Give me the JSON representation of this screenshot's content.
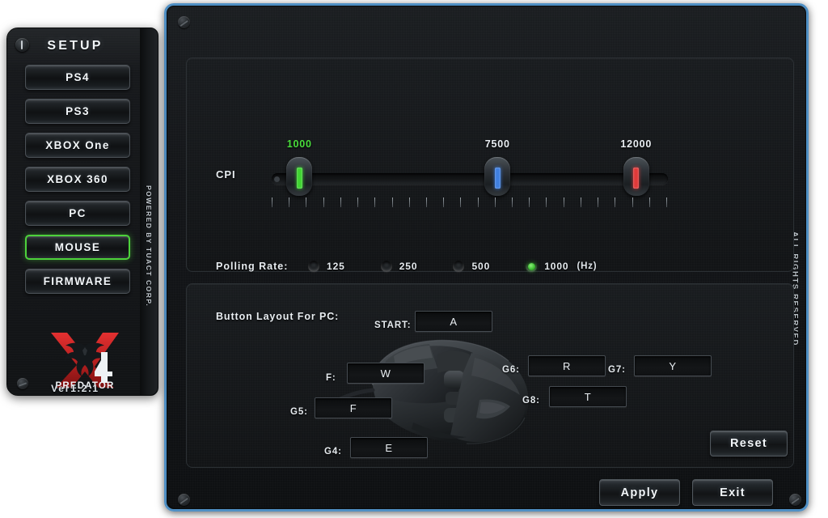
{
  "sidebar": {
    "title": "SETUP",
    "power_icon": "power-icon",
    "items": [
      {
        "label": "PS4",
        "active": false
      },
      {
        "label": "PS3",
        "active": false
      },
      {
        "label": "XBOX One",
        "active": false
      },
      {
        "label": "XBOX 360",
        "active": false
      },
      {
        "label": "PC",
        "active": false
      },
      {
        "label": "MOUSE",
        "active": true
      },
      {
        "label": "FIRMWARE",
        "active": false
      }
    ],
    "logo_brand": "PREDATOR",
    "logo_model": "4",
    "version": "Ver1.2.1",
    "rail_text": "POWERED BY TUACT CORP."
  },
  "window": {
    "rail_text": "ALL RIGHTS RESERVED.",
    "accent_border": "#4f8fc4"
  },
  "cpi": {
    "label": "CPI",
    "handles": [
      {
        "value": "1000",
        "color": "#3fd432",
        "label_color": "#4ade3c",
        "pos_pct": 7
      },
      {
        "value": "7500",
        "color": "#3f7fe0",
        "label_color": "#e9eef2",
        "pos_pct": 57
      },
      {
        "value": "12000",
        "color": "#e03a3a",
        "label_color": "#e9eef2",
        "pos_pct": 92
      }
    ],
    "tick_count": 24
  },
  "polling": {
    "label": "Polling Rate:",
    "unit": "(Hz)",
    "options": [
      {
        "label": "125",
        "selected": false
      },
      {
        "label": "250",
        "selected": false
      },
      {
        "label": "500",
        "selected": false
      },
      {
        "label": "1000",
        "selected": true
      }
    ]
  },
  "button_layout": {
    "title": "Button Layout For PC:",
    "bindings": [
      {
        "name": "START",
        "label": "START:",
        "key": "A"
      },
      {
        "name": "F",
        "label": "F:",
        "key": "W"
      },
      {
        "name": "G5",
        "label": "G5:",
        "key": "F"
      },
      {
        "name": "G4",
        "label": "G4:",
        "key": "E"
      },
      {
        "name": "G6",
        "label": "G6:",
        "key": "R"
      },
      {
        "name": "G7",
        "label": "G7:",
        "key": "Y"
      },
      {
        "name": "G8",
        "label": "G8:",
        "key": "T"
      }
    ],
    "reset_label": "Reset"
  },
  "footer": {
    "apply_label": "Apply",
    "exit_label": "Exit"
  }
}
